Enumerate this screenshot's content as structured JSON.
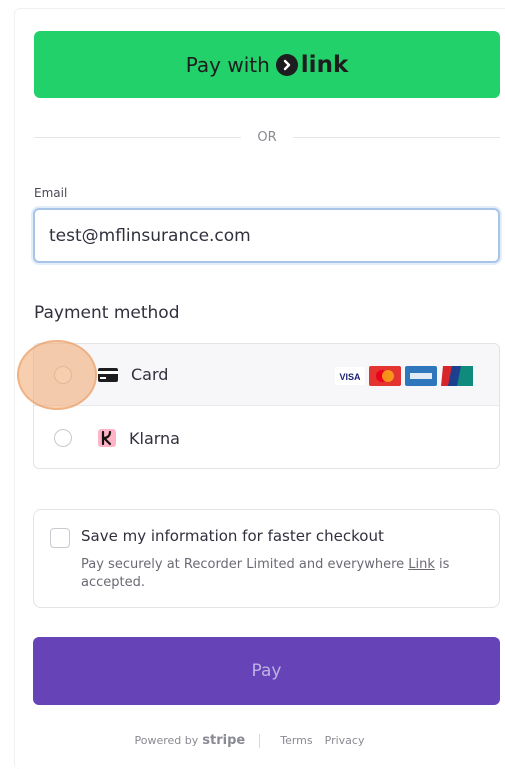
{
  "link_button": {
    "lead": "Pay with",
    "brand": "link"
  },
  "divider": {
    "text": "OR"
  },
  "email": {
    "label": "Email",
    "value": "test@mflinsurance.com"
  },
  "payment_method": {
    "title": "Payment method",
    "options": [
      {
        "label": "Card",
        "selected": false
      },
      {
        "label": "Klarna",
        "selected": false
      }
    ],
    "card_brands": {
      "visa": "VISA"
    }
  },
  "save_info": {
    "title": "Save my information for faster checkout",
    "desc_before": "Pay securely at Recorder Limited and everywhere ",
    "desc_link": "Link",
    "desc_after": " is accepted."
  },
  "pay_button": {
    "label": "Pay"
  },
  "footer": {
    "powered_by": "Powered by",
    "brand": "stripe",
    "terms": "Terms",
    "privacy": "Privacy"
  },
  "colors": {
    "link_green": "#22d16a",
    "pay_purple": "#6644b8",
    "focus_border": "#a8c4e8",
    "click_halo": "#f0a86e"
  }
}
